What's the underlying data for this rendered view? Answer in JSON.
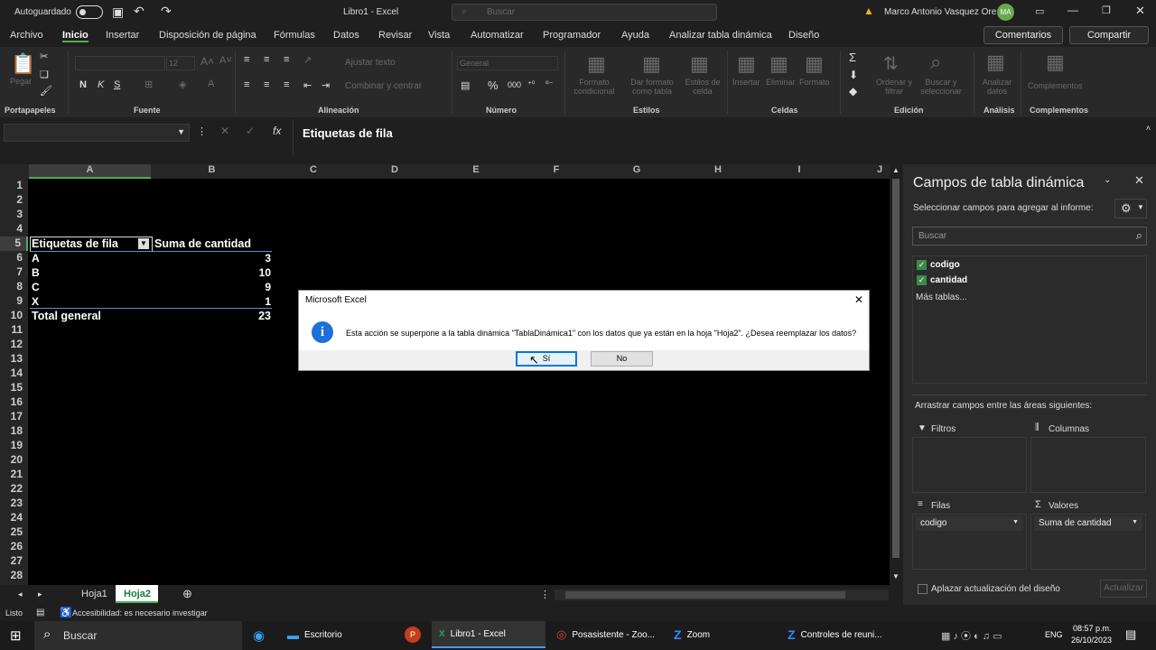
{
  "titlebar": {
    "autosave": "Autoguardado",
    "doc": "Libro1 - Excel",
    "search": "Buscar",
    "user": "Marco Antonio Vasquez Ore",
    "initials": "MA"
  },
  "menu": [
    "Archivo",
    "Inicio",
    "Insertar",
    "Disposición de página",
    "Fórmulas",
    "Datos",
    "Revisar",
    "Vista",
    "Automatizar",
    "Programador",
    "Ayuda",
    "Analizar tabla dinámica",
    "Diseño"
  ],
  "menu_right": {
    "comments": "Comentarios",
    "share": "Compartir"
  },
  "ribbon": {
    "groups": [
      "Portapapeles",
      "Fuente",
      "Alineación",
      "Número",
      "Estilos",
      "Celdas",
      "Edición",
      "Análisis",
      "Complementos"
    ],
    "paste": "Pegar",
    "font_size": "12",
    "wrap": "Ajustar texto",
    "merge": "Combinar y centrar",
    "number_format": "General",
    "cond_format": "Formato condicional",
    "table_format": "Dar formato como tabla",
    "cell_styles": "Estilos de celda",
    "insert": "Insertar",
    "delete": "Eliminar",
    "format": "Formato",
    "sort": "Ordenar y filtrar",
    "find": "Buscar y seleccionar",
    "analyze": "Analizar datos",
    "addins": "Complementos"
  },
  "formula_bar": {
    "content": "Etiquetas de fila"
  },
  "columns": [
    "A",
    "B",
    "C",
    "D",
    "E",
    "F",
    "G",
    "H",
    "I",
    "J"
  ],
  "rows": [
    "1",
    "2",
    "3",
    "4",
    "5",
    "6",
    "7",
    "8",
    "9",
    "10",
    "11",
    "12",
    "13",
    "14",
    "15",
    "16",
    "17",
    "18",
    "19",
    "20",
    "21",
    "22",
    "23",
    "24",
    "25",
    "26",
    "27",
    "28"
  ],
  "pivot": {
    "header_a": "Etiquetas de fila",
    "header_b": "Suma de cantidad",
    "rows": [
      {
        "label": "A",
        "value": "3"
      },
      {
        "label": "B",
        "value": "10"
      },
      {
        "label": "C",
        "value": "9"
      },
      {
        "label": "X",
        "value": "1"
      }
    ],
    "total_label": "Total general",
    "total_value": "23"
  },
  "sheets": {
    "tab1": "Hoja1",
    "tab2": "Hoja2"
  },
  "status": {
    "mode": "Listo",
    "accessibility": "Accesibilidad: es necesario investigar"
  },
  "dialog": {
    "title": "Microsoft Excel",
    "message": "Esta acción se superpone a la tabla dinámica \"TablaDinámica1\" con los datos que ya están en la hoja \"Hoja2\". ¿Desea reemplazar los datos?",
    "yes": "Sí",
    "no": "No"
  },
  "panel": {
    "title": "Campos de tabla dinámica",
    "subtitle": "Seleccionar campos para agregar al informe:",
    "search": "Buscar",
    "fields": [
      "codigo",
      "cantidad"
    ],
    "more": "Más tablas...",
    "drag": "Arrastrar campos entre las áreas siguientes:",
    "filters": "Filtros",
    "columns": "Columnas",
    "rows": "Filas",
    "values": "Valores",
    "row_field": "codigo",
    "value_field": "Suma de cantidad",
    "defer": "Aplazar actualización del diseño",
    "update": "Actualizar"
  },
  "taskbar": {
    "search": "Buscar",
    "items": [
      "Escritorio",
      "Libro1 - Excel",
      "Posasistente - Zoo...",
      "Zoom",
      "Controles de reuni..."
    ],
    "lang": "ENG",
    "time": "08:57 p.m.",
    "date": "26/10/2023"
  }
}
